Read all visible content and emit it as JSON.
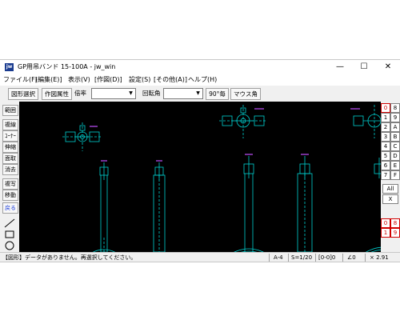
{
  "window": {
    "title": "GP用吊バンド 15-100A - jw_win",
    "icon_text": "jw"
  },
  "window_controls": {
    "minimize": "—",
    "maximize": "☐",
    "close": "✕"
  },
  "menu": [
    "ファイル(F)",
    "[編集(E)]",
    "表示(V)",
    "[作図(D)]",
    "設定(S)",
    "[その他(A)]",
    "ヘルプ(H)"
  ],
  "toolbar": {
    "select_figure": "図形選択",
    "figure_attr": "作図属性",
    "scale_label": "倍率",
    "rotation_label": "回転角",
    "ninety_button": "90°毎",
    "mouse_angle": "マウス角"
  },
  "left_tools": [
    "範囲",
    "複線",
    "ｺｰﾅｰ",
    "伸縮",
    "面取",
    "消去",
    "複写",
    "移動",
    "戻る"
  ],
  "layer_buttons": [
    "0",
    "8",
    "1",
    "9",
    "2",
    "A",
    "3",
    "B",
    "4",
    "C",
    "5",
    "D",
    "6",
    "E",
    "7",
    "F"
  ],
  "layer_all": "All",
  "layer_x": "X",
  "group_buttons": [
    "0",
    "8",
    "1",
    "9"
  ],
  "status": {
    "message": "【図形】データがありません。再選択してください。",
    "paper": "A-4",
    "scale": "S=1/20",
    "layer": "[0-0]0",
    "angle": "∠0",
    "zoom": "× 2.91"
  },
  "colors": {
    "drawing": "#00d0d0",
    "hanger": "#c050ff",
    "canvas": "#000000",
    "active_layer": "#d00000"
  }
}
